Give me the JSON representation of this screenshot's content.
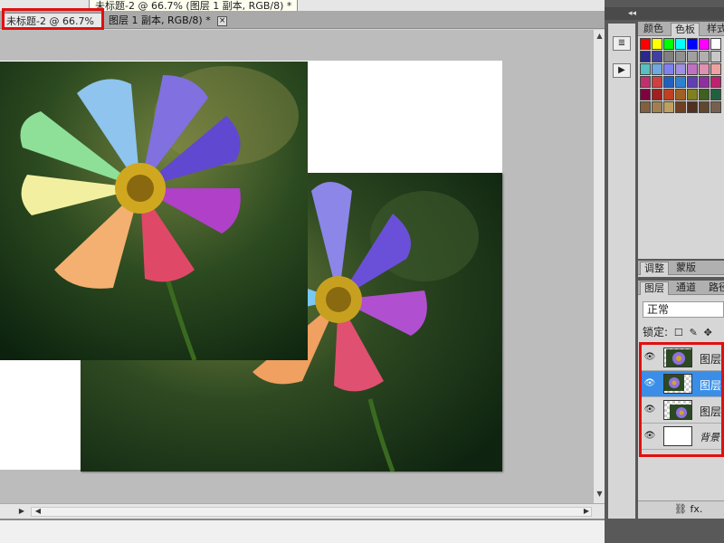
{
  "tooltip": {
    "text": "未标题-2 @ 66.7% (图层 1 副本, RGB/8) *"
  },
  "tabs": [
    {
      "label": "未标题-2 @ 66.7%",
      "active": true
    },
    {
      "label": "图层 1 副本, RGB/8) *",
      "active": false
    }
  ],
  "tab_close_glyph": "×",
  "dock": {
    "collapse_glyph": "◂◂"
  },
  "tools": [
    {
      "name": "history-icon",
      "glyph": "≣"
    },
    {
      "name": "actions-play-icon",
      "glyph": "▶"
    }
  ],
  "color_panel": {
    "tabs": [
      "颜色",
      "色板",
      "样式"
    ],
    "active_tab": 1,
    "swatches": [
      [
        "#ff0000",
        "#ffff00",
        "#00ff00",
        "#00ffff",
        "#0000ff",
        "#ff00ff",
        "#ffffff"
      ],
      [
        "#2a2a8a",
        "#4040a0",
        "#808080",
        "#909090",
        "#a0a0a0",
        "#b0b0b0",
        "#c8c8c8"
      ],
      [
        "#58c0c0",
        "#70a8e0",
        "#8080f0",
        "#a090e0",
        "#c070c0",
        "#e090b0",
        "#f0a0a0"
      ],
      [
        "#c03070",
        "#d04040",
        "#2060c0",
        "#3080d0",
        "#6040b0",
        "#9030a0",
        "#c02070"
      ],
      [
        "#800040",
        "#a02020",
        "#c04020",
        "#a06020",
        "#808020",
        "#406020",
        "#206040"
      ],
      [
        "#806040",
        "#a08050",
        "#c0a060",
        "#704020",
        "#503020",
        "#604830",
        "#786050"
      ]
    ]
  },
  "adjust_panel": {
    "tabs": [
      "调整",
      "蒙版"
    ],
    "active_tab": 0
  },
  "layers_panel": {
    "tabs": [
      "图层",
      "通道",
      "路径"
    ],
    "active_tab": 0,
    "blend_mode": "正常",
    "lock_label": "锁定:",
    "lock_icons": [
      "☐",
      "✎",
      "✥"
    ],
    "layers": [
      {
        "name": "图层",
        "thumb": "photo",
        "selected": false,
        "italic": false
      },
      {
        "name": "图层",
        "thumb": "photo",
        "selected": true,
        "italic": false
      },
      {
        "name": "图层",
        "thumb": "photo",
        "selected": false,
        "italic": false
      },
      {
        "name": "背景",
        "thumb": "white",
        "selected": false,
        "italic": true
      }
    ],
    "eye_glyph": "👁",
    "footer": "⛓  fx."
  },
  "colors": {
    "highlight": "#e01010",
    "selection": "#3a8ee8"
  }
}
